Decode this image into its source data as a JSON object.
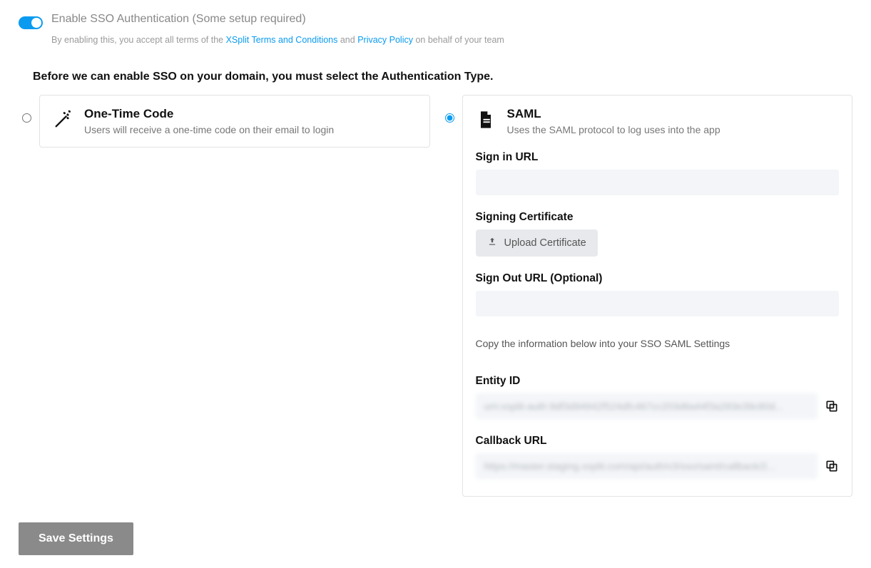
{
  "toggle": {
    "title": "Enable SSO Authentication (Some setup required)",
    "sub_prefix": "By enabling this, you accept all terms of the ",
    "terms_link": "XSplit Terms and Conditions",
    "sub_mid": " and ",
    "privacy_link": "Privacy Policy",
    "sub_suffix": " on behalf of your team"
  },
  "heading": "Before we can enable SSO on your domain, you must select the Authentication Type.",
  "otc": {
    "title": "One-Time Code",
    "desc": "Users will receive a one-time code on their email to login"
  },
  "saml": {
    "title": "SAML",
    "desc": "Uses the SAML protocol to log uses into the app",
    "signin_label": "Sign in URL",
    "signin_value": "",
    "cert_label": "Signing Certificate",
    "upload_label": "Upload Certificate",
    "signout_label": "Sign Out URL (Optional)",
    "signout_value": "",
    "info_text": "Copy the information below into your SSO SAML Settings",
    "entity_label": "Entity ID",
    "entity_value": "urn:xsplit-auth:9df3d94942f524dfc467cc203d6a44f3a283e39c80d...",
    "callback_label": "Callback URL",
    "callback_value": "https://master.staging.xsplit.com/api/auth/v3/sso/saml/callback/2..."
  },
  "save_label": "Save Settings"
}
